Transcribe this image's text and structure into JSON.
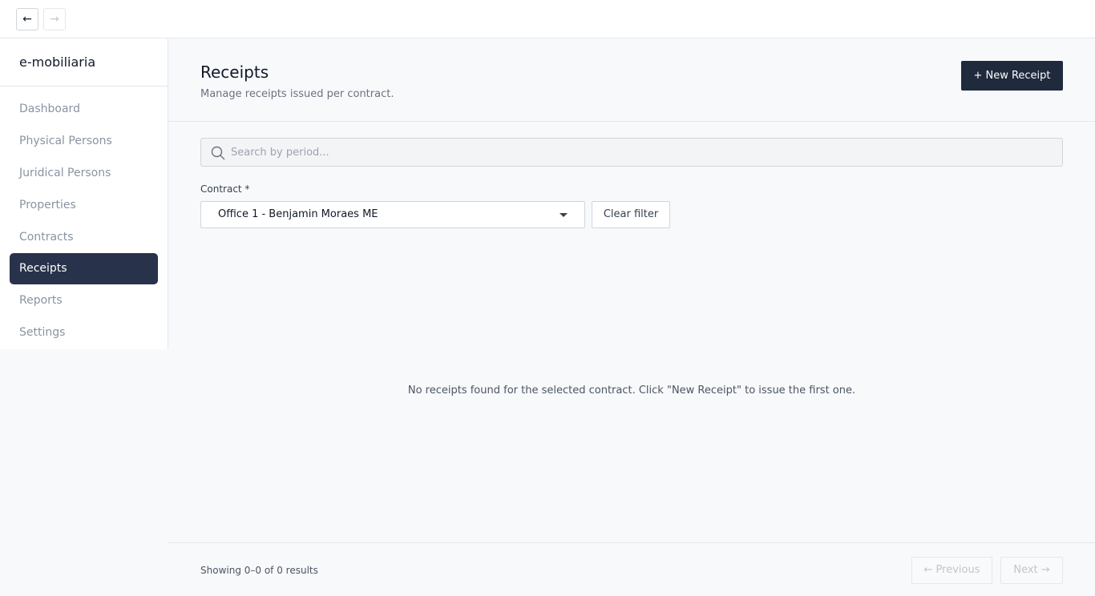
{
  "topbar": {
    "back_icon": "←",
    "forward_icon": "→"
  },
  "sidebar": {
    "brand": "e-mobiliaria",
    "items": [
      {
        "label": "Dashboard"
      },
      {
        "label": "Physical Persons"
      },
      {
        "label": "Juridical Persons"
      },
      {
        "label": "Properties"
      },
      {
        "label": "Contracts"
      },
      {
        "label": "Receipts"
      },
      {
        "label": "Reports"
      },
      {
        "label": "Settings"
      }
    ],
    "active": "Receipts"
  },
  "header": {
    "title": "Receipts",
    "subtitle": "Manage receipts issued per contract.",
    "new_button": "+ New Receipt"
  },
  "search": {
    "placeholder": "Search by period..."
  },
  "filter": {
    "label": "Contract *",
    "selected": "Office 1 - Benjamin Moraes ME",
    "clear_label": "Clear filter"
  },
  "empty_message": "No receipts found for the selected contract. Click \"New Receipt\" to issue the first one.",
  "pagination": {
    "results": "Showing 0–0 of 0 results",
    "previous": "← Previous",
    "next": "Next →"
  },
  "colors": {
    "accent": "#1f2a3c",
    "active_nav": "#28324a"
  }
}
